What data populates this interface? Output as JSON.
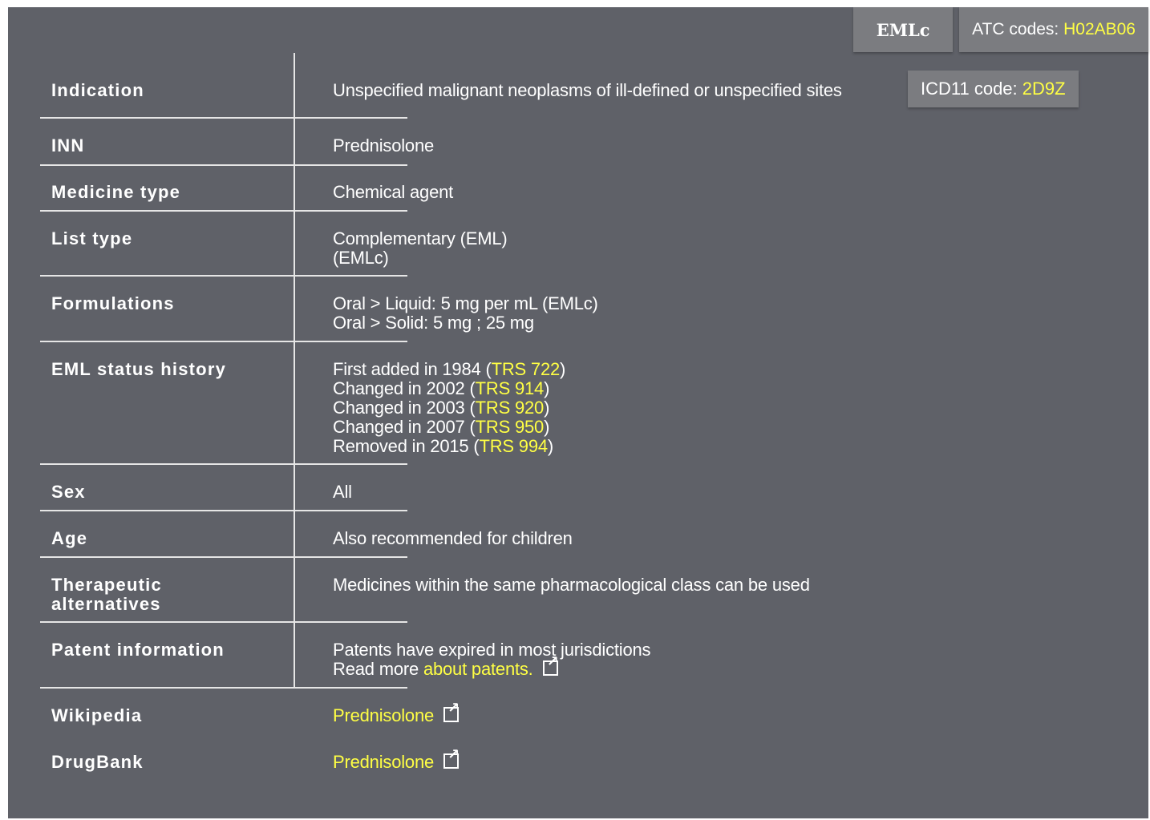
{
  "tabs": {
    "eml": "EMLc",
    "atc_label": "ATC codes: ",
    "atc_code": "H02AB06"
  },
  "rows": {
    "indication": {
      "label": "Indication",
      "value": "Unspecified malignant neoplasms of ill-defined or unspecified sites",
      "icd_label": "ICD11 code: ",
      "icd_code": "2D9Z"
    },
    "inn": {
      "label": "INN",
      "value": "Prednisolone"
    },
    "medicine_type": {
      "label": "Medicine type",
      "value": "Chemical agent"
    },
    "list_type": {
      "label": "List type",
      "line1": "Complementary (EML)",
      "line2": "(EMLc)"
    },
    "formulations": {
      "label": "Formulations",
      "line1": "Oral > Liquid: 5 mg per mL (EMLc)",
      "line2": "Oral > Solid: 5 mg ; 25 mg"
    },
    "eml_status_history": {
      "label": "EML status history",
      "entries": [
        {
          "text": "First added in 1984 (",
          "link": "TRS 722",
          "close": ")"
        },
        {
          "text": "Changed in 2002 (",
          "link": "TRS 914",
          "close": ")"
        },
        {
          "text": "Changed in 2003 (",
          "link": "TRS 920",
          "close": ")"
        },
        {
          "text": "Changed in 2007 (",
          "link": "TRS 950",
          "close": ")"
        },
        {
          "text": "Removed in 2015 (",
          "link": "TRS 994",
          "close": ")"
        }
      ]
    },
    "sex": {
      "label": "Sex",
      "value": "All"
    },
    "age": {
      "label": "Age",
      "value": "Also recommended for children"
    },
    "therapeutic_alternatives": {
      "label_line1": "Therapeutic",
      "label_line2": "alternatives",
      "value": "Medicines within the same pharmacological class can be used"
    },
    "patent_information": {
      "label": "Patent information",
      "line1": "Patents have expired in most jurisdictions",
      "read_more": "Read more ",
      "link": "about patents."
    },
    "wikipedia": {
      "label": "Wikipedia",
      "link": "Prednisolone"
    },
    "drugbank": {
      "label": "DrugBank",
      "link": "Prednisolone"
    }
  },
  "colors": {
    "panel_bg": "#5f6168",
    "button_bg": "#7b7c80",
    "link": "#ffff44",
    "text": "#ffffff"
  },
  "icons": [
    "external-link-icon"
  ]
}
